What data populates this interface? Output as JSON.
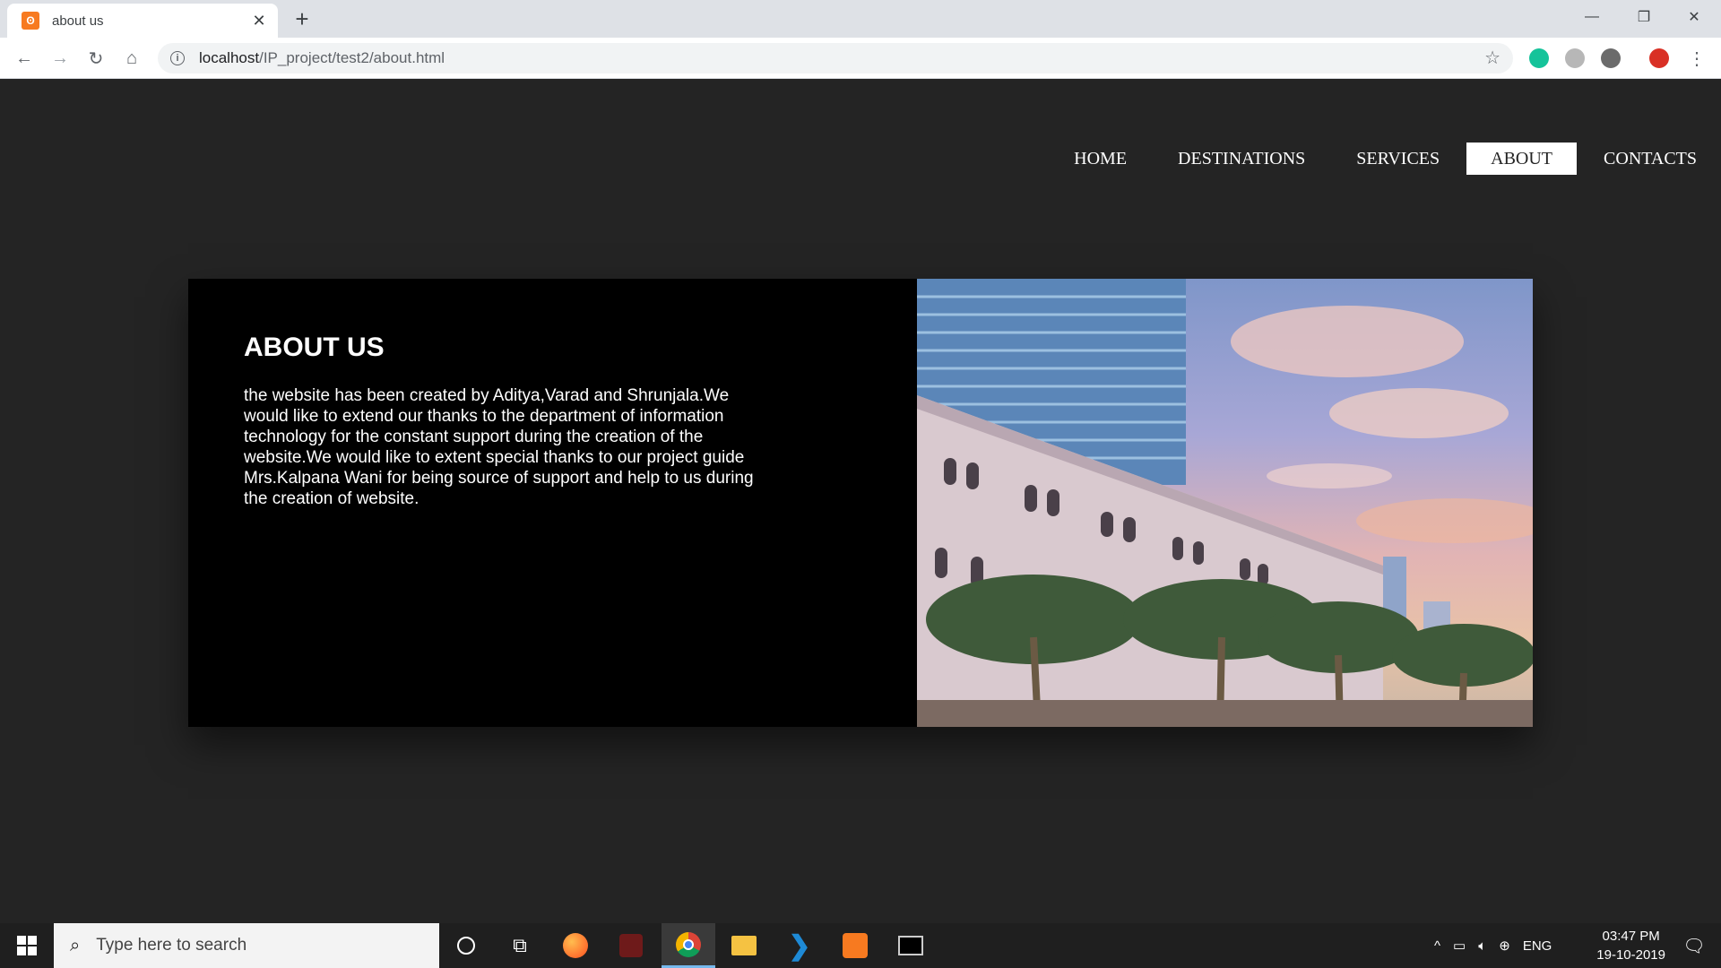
{
  "browser": {
    "tab_title": "about us",
    "tab_favicon": "xampp-icon",
    "url_host": "localhost",
    "url_path": "/IP_project/test2/about.html"
  },
  "site": {
    "nav": [
      {
        "label": "HOME",
        "active": false
      },
      {
        "label": "DESTINATIONS",
        "active": false
      },
      {
        "label": "SERVICES",
        "active": false
      },
      {
        "label": "ABOUT",
        "active": true
      },
      {
        "label": "CONTACTS",
        "active": false
      }
    ],
    "about_title": "ABOUT US",
    "about_body": "the website has been created by Aditya,Varad and Shrunjala.We would like to extend our thanks to the department of information technology for the constant support during the creation of the website.We would like to extent special thanks to our project guide Mrs.Kalpana Wani for being source of support and help to us during the creation of website."
  },
  "taskbar": {
    "search_placeholder": "Type here to search",
    "language": "ENG",
    "time": "03:47 PM",
    "date": "19-10-2019"
  },
  "colors": {
    "page_bg": "#242424",
    "card_bg": "#000000",
    "nav_active_bg": "#ffffff"
  }
}
